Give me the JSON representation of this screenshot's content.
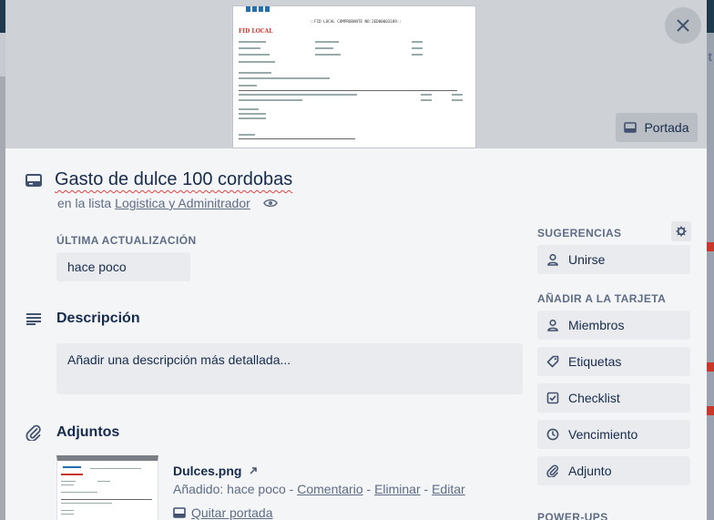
{
  "cover": {
    "button_label": "Portada",
    "preview": {
      "logo_text": "FID LOCAL",
      "doc_title": "::FID LOCAL COMPROBANTE NO:2ED00003189::"
    }
  },
  "card": {
    "title": "Gasto de dulce 100 cordobas",
    "list_prefix": "en la lista",
    "list_name": "Logistica y Adminitrador"
  },
  "last_update": {
    "label": "ÚLTIMA ACTUALIZACIÓN",
    "value": "hace poco"
  },
  "description": {
    "heading": "Descripción",
    "placeholder": "Añadir una descripción más detallada..."
  },
  "attachments": {
    "heading": "Adjuntos",
    "items": [
      {
        "name": "Dulces.png",
        "added_prefix": "Añadido:",
        "added_time": "hace poco",
        "actions": [
          "Comentario",
          "Eliminar",
          "Editar"
        ],
        "cover_action": "Quitar portada"
      }
    ]
  },
  "sidebar": {
    "suggestions_label": "SUGERENCIAS",
    "join_label": "Unirse",
    "add_label": "AÑADIR A LA TARJETA",
    "buttons": [
      "Miembros",
      "Etiquetas",
      "Checklist",
      "Vencimiento",
      "Adjunto"
    ],
    "powerups_label": "POWER-UPS"
  },
  "icons": {
    "close": "close-icon",
    "card": "card-icon",
    "eye": "eye-icon",
    "description": "description-lines-icon",
    "attachment": "paperclip-icon",
    "gear": "gear-icon",
    "person": "person-icon",
    "label": "tag-icon",
    "checklist": "checklist-icon",
    "clock": "clock-icon",
    "external": "external-arrow-icon"
  },
  "colors": {
    "text": "#172b4d",
    "muted": "#5e6c84",
    "surface": "#f4f5f7",
    "button": "#e9ebee",
    "spell": "#e04444"
  }
}
